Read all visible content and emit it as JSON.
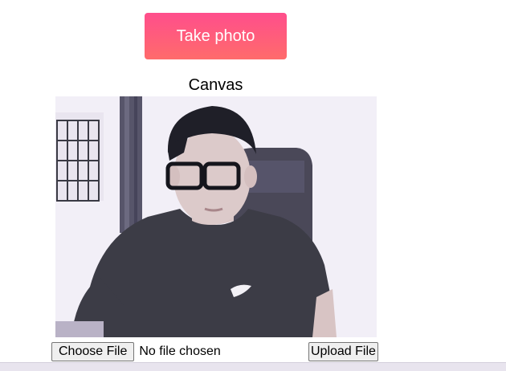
{
  "header": {
    "take_photo_label": "Take photo"
  },
  "canvas": {
    "heading": "Canvas"
  },
  "file_upload": {
    "choose_label": "Choose File",
    "status_text": "No file chosen",
    "upload_label": "Upload File"
  },
  "colors": {
    "button_gradient_top": "#ff4e8c",
    "button_gradient_bottom": "#ff6b6b"
  }
}
